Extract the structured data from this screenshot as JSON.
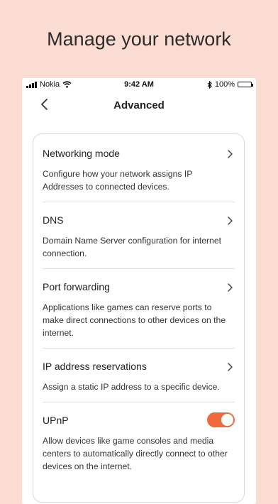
{
  "headline": "Manage your network",
  "statusbar": {
    "carrier": "Nokia",
    "time": "9:42 AM",
    "battery": "100%"
  },
  "nav": {
    "title": "Advanced"
  },
  "settings": {
    "items": [
      {
        "title": "Networking mode",
        "description": "Configure how your network assigns IP Addresses to connected devices."
      },
      {
        "title": "DNS",
        "description": "Domain Name Server configuration for internet connection."
      },
      {
        "title": "Port forwarding",
        "description": "Applications like games can reserve ports to make direct connections to other devices on the internet."
      },
      {
        "title": "IP address reservations",
        "description": "Assign a static IP address to a specific device."
      }
    ],
    "upnp": {
      "title": "UPnP",
      "description": "Allow devices like game consoles and media centers to automatically directly connect to other devices on the internet.",
      "enabled": true
    }
  },
  "colors": {
    "accent": "#ec6a3c",
    "background": "#fbdcd3"
  },
  "icons": [
    "back-chevron-icon",
    "chevron-right-icon",
    "wifi-icon",
    "bluetooth-icon",
    "battery-icon",
    "signal-icon"
  ]
}
